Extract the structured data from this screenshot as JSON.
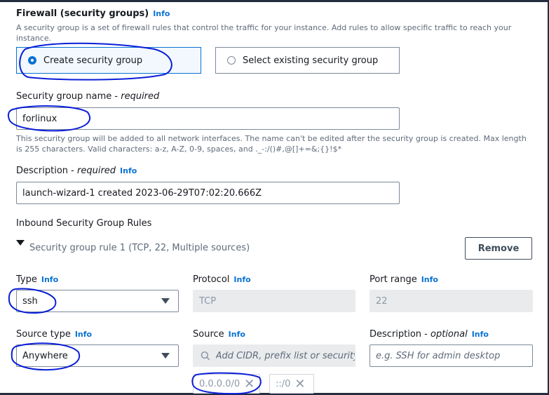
{
  "section": {
    "title": "Firewall (security groups)",
    "info": "Info",
    "description": "A security group is a set of firewall rules that control the traffic for your instance. Add rules to allow specific traffic to reach your instance."
  },
  "sg_choice": {
    "create_label": "Create security group",
    "select_label": "Select existing security group",
    "selected": "create"
  },
  "sg_name": {
    "label": "Security group name - ",
    "label_req": "required",
    "value": "forlinux",
    "hint": "This security group will be added to all network interfaces. The name can't be edited after the security group is created. Max length is 255 characters. Valid characters: a-z, A-Z, 0-9, spaces, and ._-:/()#,@[]+=&;{}!$*"
  },
  "description_field": {
    "label": "Description - ",
    "label_req": "required",
    "info": "Info",
    "value": "launch-wizard-1 created 2023-06-29T07:02:20.666Z"
  },
  "inbound": {
    "title": "Inbound Security Group Rules",
    "rule_title": "Security group rule 1 (TCP, 22, Multiple sources)",
    "remove_label": "Remove"
  },
  "rule": {
    "type_label": "Type",
    "type_info": "Info",
    "type_value": "ssh",
    "protocol_label": "Protocol",
    "protocol_info": "Info",
    "protocol_value": "TCP",
    "port_label": "Port range",
    "port_info": "Info",
    "port_value": "22",
    "source_type_label": "Source type",
    "source_type_info": "Info",
    "source_type_value": "Anywhere",
    "source_label": "Source",
    "source_info": "Info",
    "source_placeholder": "Add CIDR, prefix list or security",
    "desc_label": "Description - ",
    "desc_opt": "optional",
    "desc_info": "Info",
    "desc_placeholder": "e.g. SSH for admin desktop",
    "tokens": [
      "0.0.0.0/0",
      "::/0"
    ]
  },
  "icons": {
    "search": "search-icon",
    "remove_token": "close-icon",
    "dropdown": "caret-down-icon",
    "expand": "caret-down-icon"
  },
  "colors": {
    "accent": "#0972d3",
    "annotation": "#0a1ed8"
  }
}
